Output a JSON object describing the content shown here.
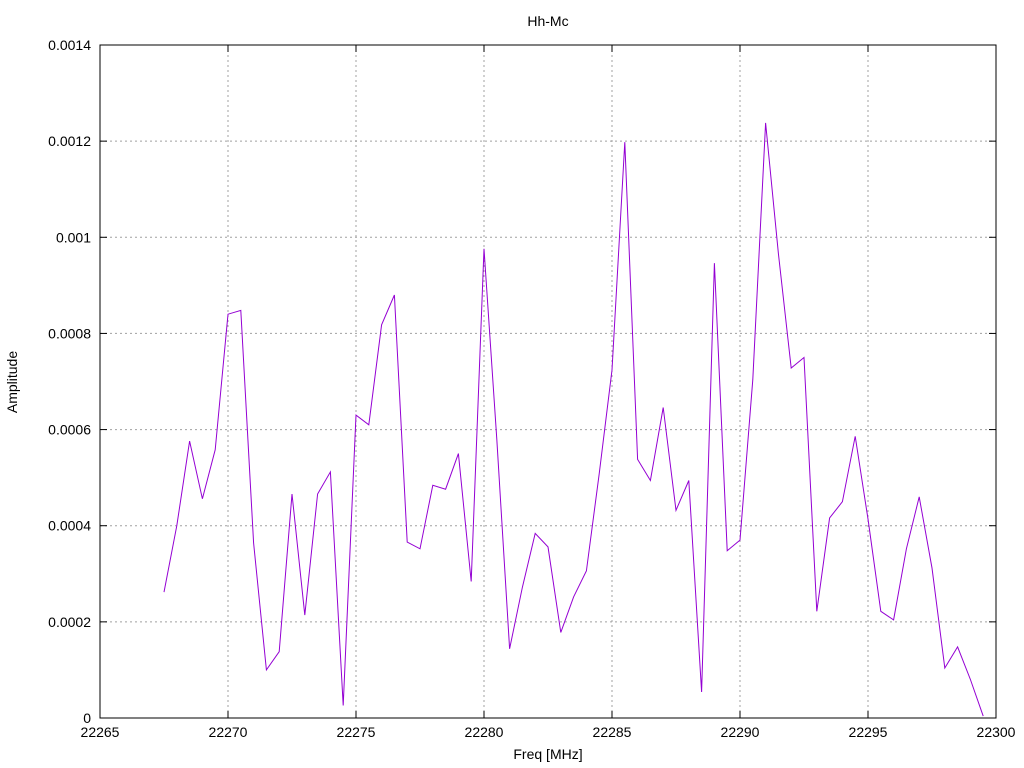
{
  "chart_data": {
    "type": "line",
    "title": "Hh-Mc",
    "xlabel": "Freq [MHz]",
    "ylabel": "Amplitude",
    "xlim": [
      22265,
      22300
    ],
    "ylim": [
      0,
      0.0014
    ],
    "x_ticks": [
      22265,
      22270,
      22275,
      22280,
      22285,
      22290,
      22295,
      22300
    ],
    "x_tick_labels": [
      "22265",
      "22270",
      "22275",
      "22280",
      "22285",
      "22290",
      "22295",
      "22300"
    ],
    "y_ticks": [
      0,
      0.0002,
      0.0004,
      0.0006,
      0.0008,
      0.001,
      0.0012,
      0.0014
    ],
    "y_tick_labels": [
      "0",
      "0.0002",
      "0.0004",
      "0.0006",
      "0.0008",
      "0.001",
      "0.0012",
      "0.0014"
    ],
    "grid": true,
    "series": [
      {
        "color": "#9400d3",
        "x": [
          22267.5,
          22268.0,
          22268.5,
          22269.0,
          22269.5,
          22270.0,
          22270.5,
          22271.0,
          22271.5,
          22272.0,
          22272.5,
          22273.0,
          22273.5,
          22274.0,
          22274.5,
          22275.0,
          22275.5,
          22276.0,
          22276.5,
          22277.0,
          22277.5,
          22278.0,
          22278.5,
          22279.0,
          22279.5,
          22280.0,
          22280.5,
          22281.0,
          22281.5,
          22282.0,
          22282.5,
          22283.0,
          22283.5,
          22284.0,
          22284.5,
          22285.0,
          22285.5,
          22286.0,
          22286.5,
          22287.0,
          22287.5,
          22288.0,
          22288.5,
          22289.0,
          22289.5,
          22290.0,
          22290.5,
          22291.0,
          22291.5,
          22292.0,
          22292.5,
          22293.0,
          22293.5,
          22294.0,
          22294.5,
          22295.0,
          22295.5,
          22296.0,
          22296.5,
          22297.0,
          22297.5,
          22298.0,
          22298.5,
          22299.0,
          22299.5
        ],
        "y": [
          0.000262,
          0.0004,
          0.000576,
          0.000456,
          0.000558,
          0.00084,
          0.000848,
          0.000364,
          0.0001,
          0.000138,
          0.000466,
          0.000214,
          0.000466,
          0.000512,
          2.6e-05,
          0.00063,
          0.00061,
          0.000818,
          0.00088,
          0.000366,
          0.000352,
          0.000484,
          0.000476,
          0.00055,
          0.000284,
          0.000976,
          0.00058,
          0.000144,
          0.000272,
          0.000384,
          0.000356,
          0.000178,
          0.000252,
          0.000306,
          0.000508,
          0.000724,
          0.001198,
          0.000538,
          0.000494,
          0.000646,
          0.000432,
          0.000494,
          5.4e-05,
          0.000946,
          0.000348,
          0.00037,
          0.000704,
          0.001238,
          0.000966,
          0.000728,
          0.00075,
          0.000222,
          0.000416,
          0.00045,
          0.000586,
          0.000414,
          0.000222,
          0.000204,
          0.000352,
          0.00046,
          0.000312,
          0.000104,
          0.000148,
          8e-05,
          4e-06
        ]
      }
    ]
  }
}
